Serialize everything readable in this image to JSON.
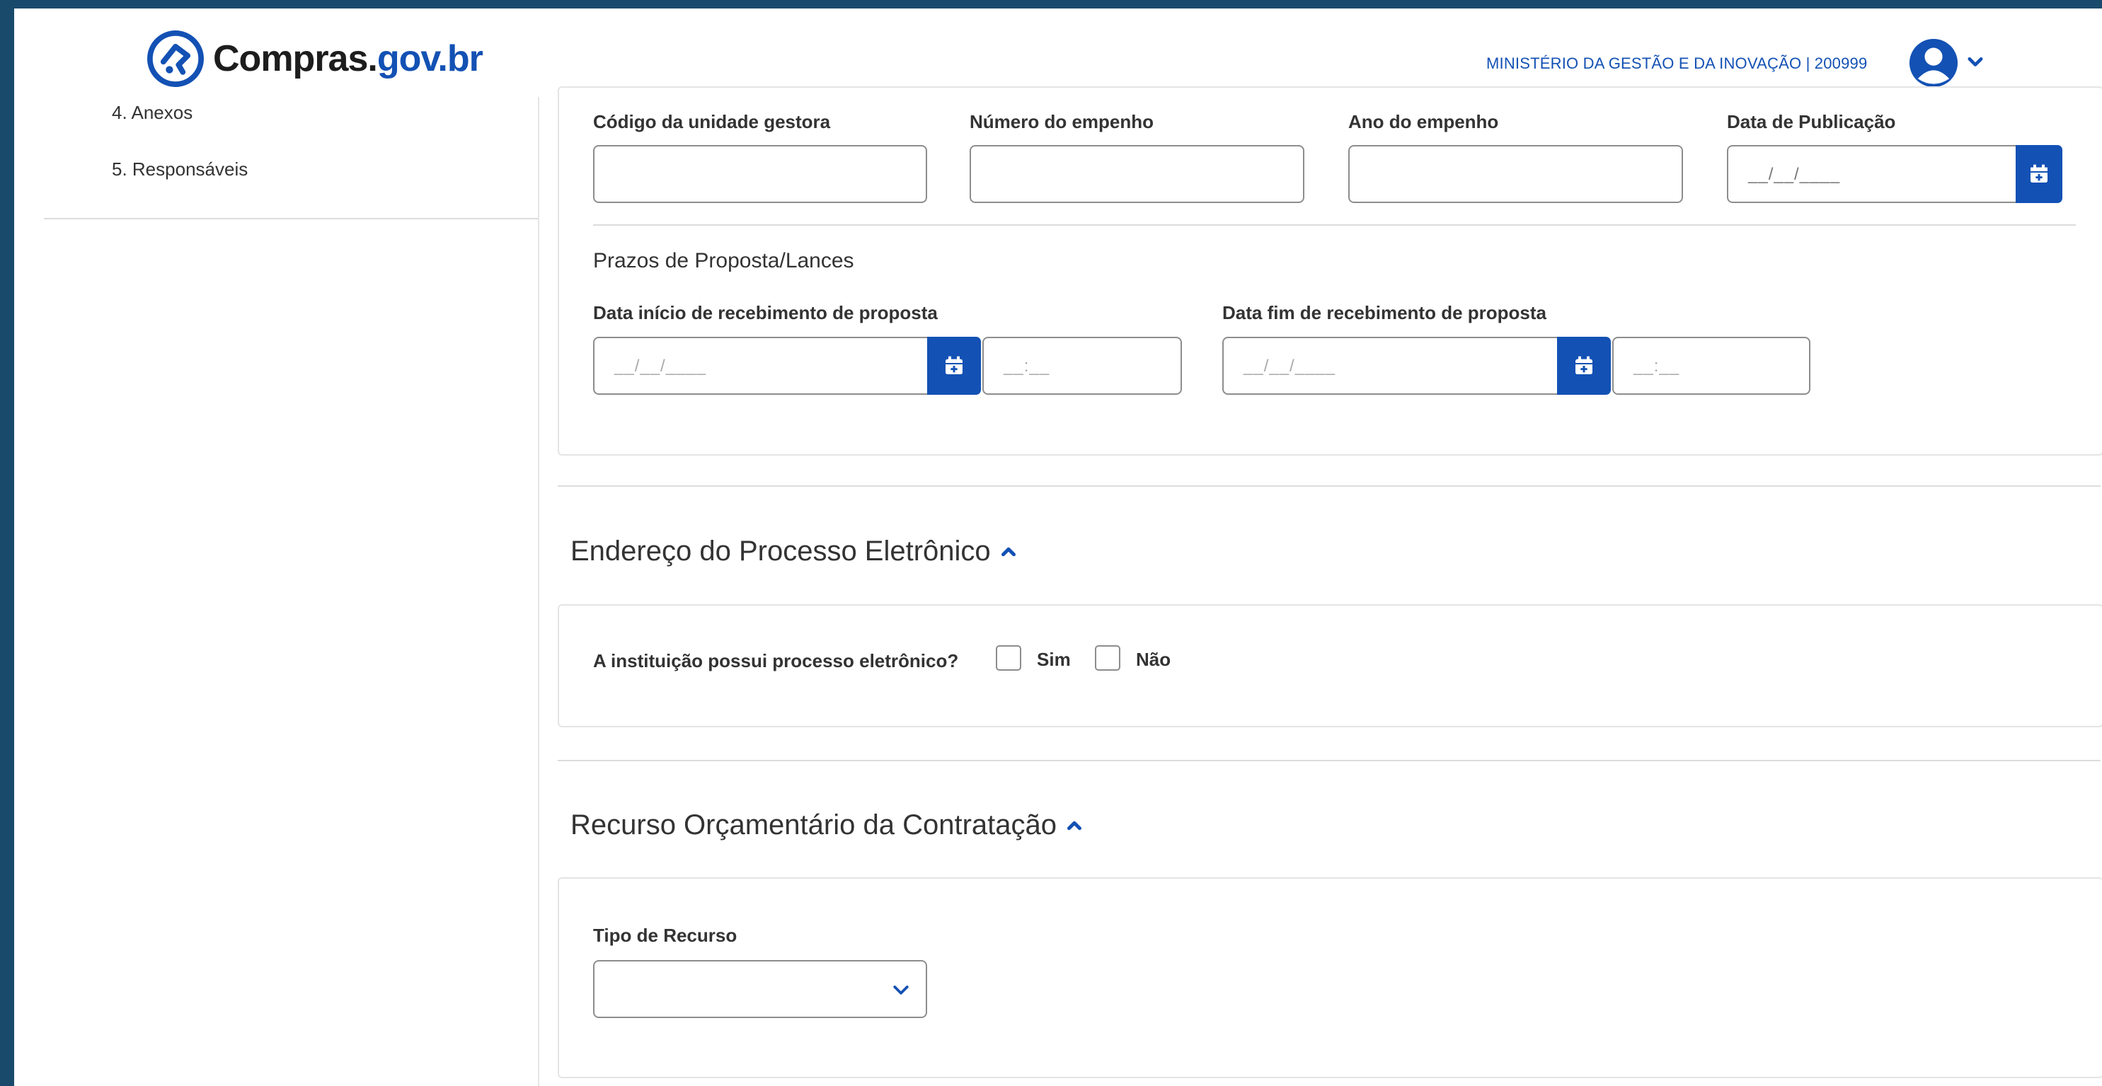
{
  "header": {
    "logo_part1": "Compras.",
    "logo_part2": "gov.br",
    "organization": "MINISTÉRIO DA GESTÃO E DA INOVAÇÃO | 200999"
  },
  "sidebar": {
    "items": [
      {
        "label": "4. Anexos"
      },
      {
        "label": "5. Responsáveis"
      }
    ]
  },
  "empenho": {
    "codigo_label": "Código da unidade gestora",
    "numero_label": "Número do empenho",
    "ano_label": "Ano do empenho",
    "data_publicacao_label": "Data de Publicação",
    "data_publicacao_placeholder": "__/__/____"
  },
  "prazos": {
    "heading": "Prazos de Proposta/Lances",
    "inicio_label": "Data início de recebimento de proposta",
    "fim_label": "Data fim de recebimento de proposta",
    "date_placeholder": "__/__/____",
    "time_placeholder": "__:__"
  },
  "processo": {
    "title": "Endereço do Processo Eletrônico",
    "question": "A instituição possui processo eletrônico?",
    "option_yes": "Sim",
    "option_no": "Não"
  },
  "recurso": {
    "title": "Recurso Orçamentário da Contratação",
    "tipo_label": "Tipo de Recurso",
    "tipo_value": ""
  },
  "colors": {
    "primary": "#1351b4",
    "border": "#8d8d8d",
    "text": "#333333"
  },
  "icons": [
    "logo-icon",
    "user-avatar-icon",
    "chevron-down-icon",
    "calendar-icon",
    "chevron-up-icon"
  ]
}
